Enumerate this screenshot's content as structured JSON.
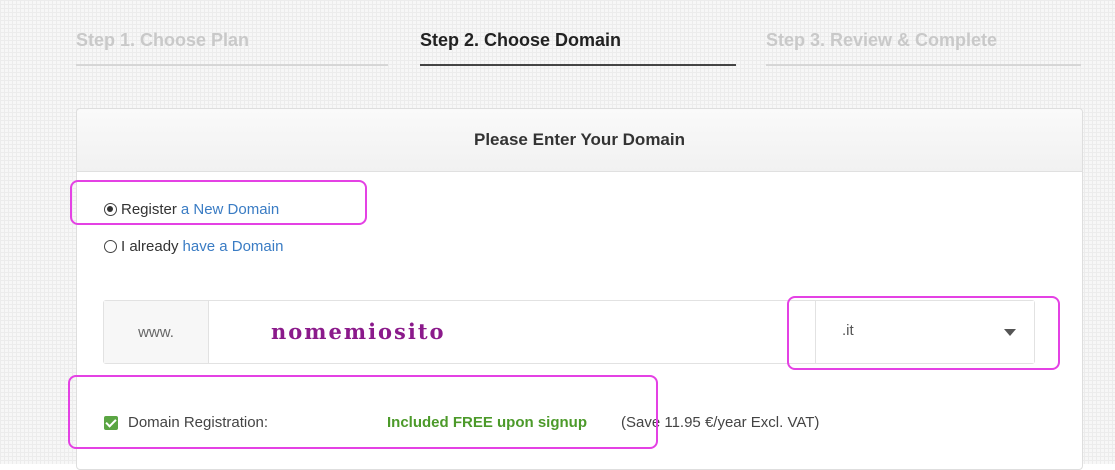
{
  "steps": [
    {
      "label": "Step 1. Choose Plan",
      "state": "inactive"
    },
    {
      "label": "Step 2. Choose Domain",
      "state": "active"
    },
    {
      "label": "Step 3. Review & Complete",
      "state": "inactive"
    }
  ],
  "panel": {
    "title": "Please Enter Your Domain"
  },
  "domain_type": {
    "options": [
      {
        "prefix": "Register",
        "link": "a New Domain",
        "checked": true
      },
      {
        "prefix": "I already",
        "link": "have a Domain",
        "checked": false
      }
    ]
  },
  "domain_input": {
    "prefix": "www.",
    "value": "nomemiosito",
    "tld": ".it"
  },
  "registration": {
    "label": "Domain Registration:",
    "price": "Included FREE upon signup",
    "savings": "(Save 11.95 €/year Excl. VAT)",
    "checked": true
  },
  "colors": {
    "link": "#3a7cc4",
    "free": "#4c9a2a",
    "checkbox": "#5aa543",
    "highlight": "#e441e4",
    "domain_text": "#8b1a8b"
  }
}
